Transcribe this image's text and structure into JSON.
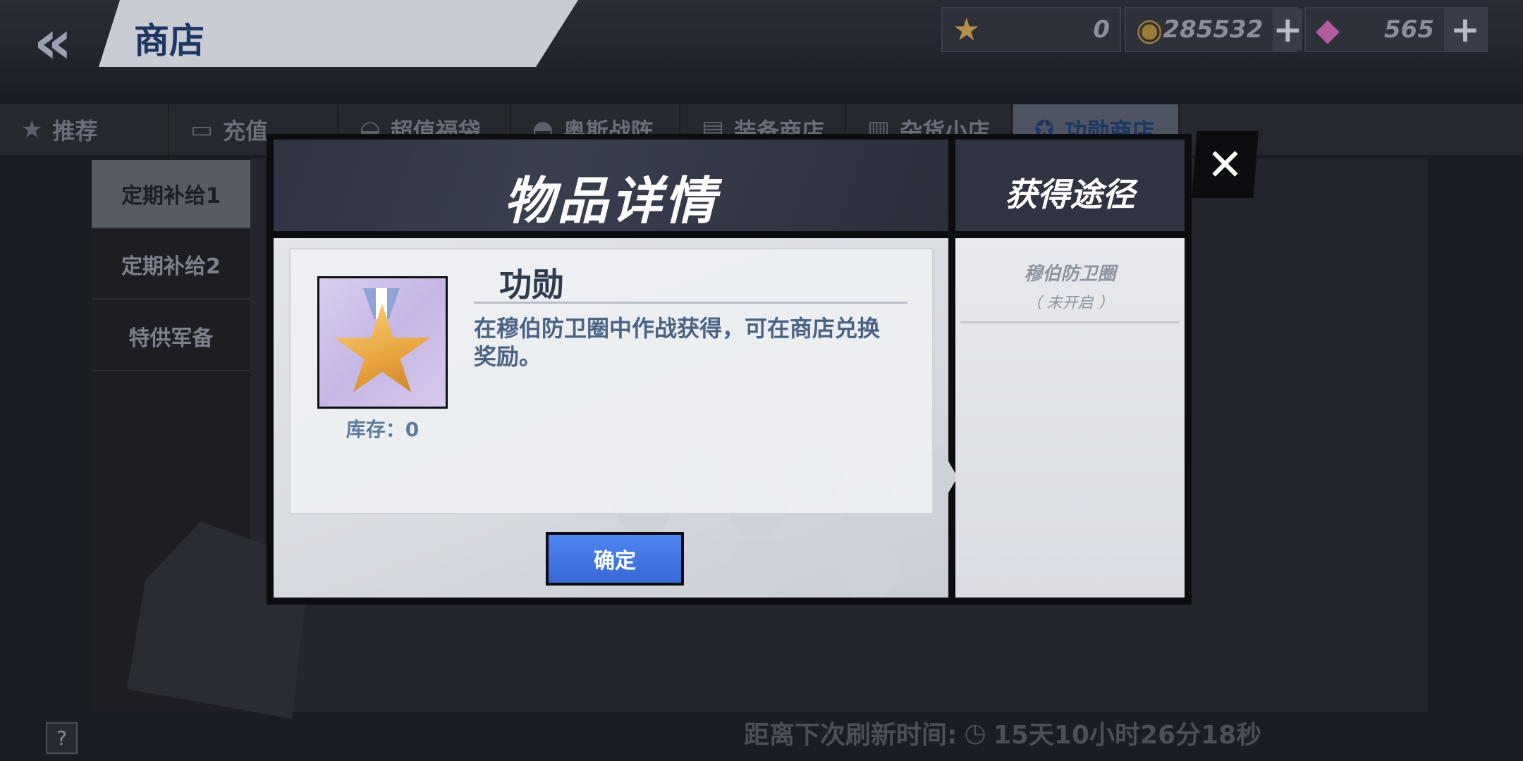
{
  "nav": {
    "back_icon": "double-chevron-left-icon",
    "title": "商店"
  },
  "currencies": {
    "merit": {
      "icon": "merit-medal-icon",
      "value": "0"
    },
    "gold": {
      "icon": "gold-coin-icon",
      "value": "285532",
      "plus": "+"
    },
    "gem": {
      "icon": "gem-icon",
      "value": "565",
      "plus": "+"
    }
  },
  "tabs": [
    {
      "label": "推荐",
      "icon": "star-icon"
    },
    {
      "label": "充值",
      "icon": "wallet-icon"
    },
    {
      "label": "超值福袋",
      "icon": "bag-icon"
    },
    {
      "label": "奥斯战阵",
      "icon": "helmet-icon"
    },
    {
      "label": "装备商店",
      "icon": "equipment-icon"
    },
    {
      "label": "杂货小店",
      "icon": "shop-icon"
    },
    {
      "label": "功勋商店",
      "icon": "merit-icon",
      "active": true
    }
  ],
  "sidebar": {
    "items": [
      {
        "label": "定期补给1"
      },
      {
        "label": "定期补给2"
      },
      {
        "label": "特供军备"
      }
    ]
  },
  "refresh": {
    "label": "距离下次刷新时间:",
    "icon": "clock-icon",
    "time": "15天10小时26分18秒"
  },
  "help": {
    "label": "?"
  },
  "modal": {
    "detail_title": "物品详情",
    "source_title": "获得途径",
    "close": "✕",
    "item": {
      "name": "功勋",
      "description": "在穆伯防卫圈中作战获得，可在商店兑换奖励。",
      "stock_label": "库存：",
      "stock_value": "0",
      "icon": "merit-medal-icon"
    },
    "confirm_label": "确定",
    "source": {
      "name": "穆伯防卫圈",
      "state": "（ 未开启 ）"
    }
  }
}
